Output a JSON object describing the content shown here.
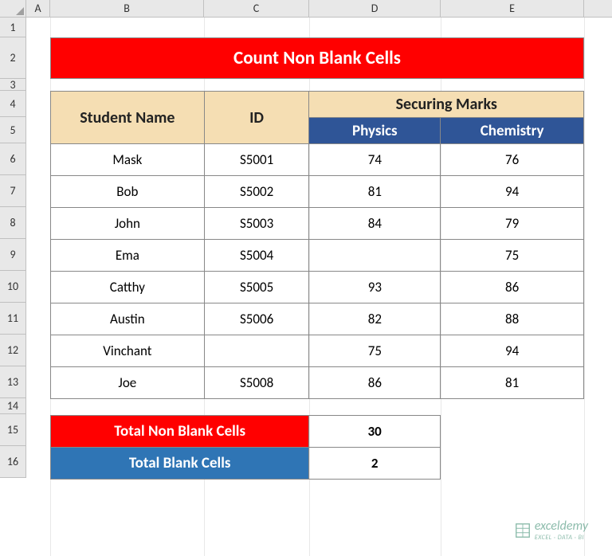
{
  "columns": [
    "A",
    "B",
    "C",
    "D",
    "E"
  ],
  "rows": [
    "1",
    "2",
    "3",
    "4",
    "5",
    "6",
    "7",
    "8",
    "9",
    "10",
    "11",
    "12",
    "13",
    "14",
    "15",
    "16"
  ],
  "title": "Count Non Blank Cells",
  "headers": {
    "student_name": "Student Name",
    "id": "ID",
    "securing_marks": "Securing Marks",
    "physics": "Physics",
    "chemistry": "Chemistry"
  },
  "students": [
    {
      "name": "Mask",
      "id": "S5001",
      "physics": "74",
      "chemistry": "76"
    },
    {
      "name": "Bob",
      "id": "S5002",
      "physics": "81",
      "chemistry": "94"
    },
    {
      "name": "John",
      "id": "S5003",
      "physics": "84",
      "chemistry": "79"
    },
    {
      "name": "Ema",
      "id": "S5004",
      "physics": "",
      "chemistry": "75"
    },
    {
      "name": "Catthy",
      "id": "S5005",
      "physics": "93",
      "chemistry": "86"
    },
    {
      "name": "Austin",
      "id": "S5006",
      "physics": "82",
      "chemistry": "88"
    },
    {
      "name": "Vinchant",
      "id": "",
      "physics": "75",
      "chemistry": "94"
    },
    {
      "name": "Joe",
      "id": "S5008",
      "physics": "86",
      "chemistry": "81"
    }
  ],
  "summary": {
    "non_blank_label": "Total Non Blank Cells",
    "non_blank_value": "30",
    "blank_label": "Total Blank Cells",
    "blank_value": "2"
  },
  "watermark": {
    "text": "exceldemy",
    "sub": "EXCEL · DATA · BI"
  }
}
